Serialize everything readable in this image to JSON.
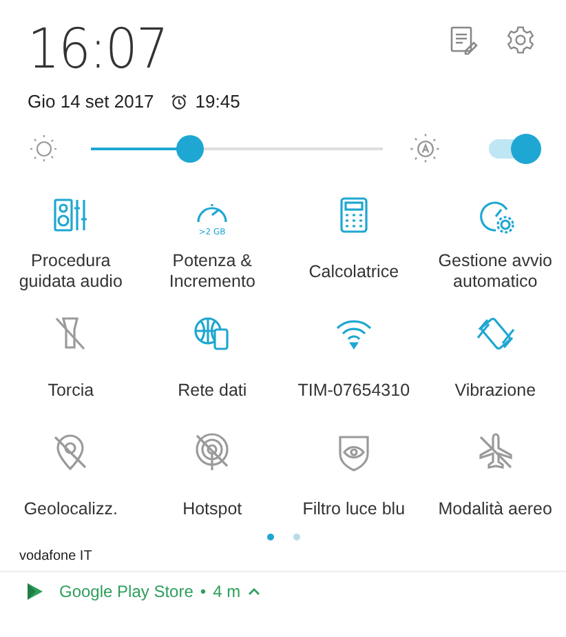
{
  "header": {
    "time": "16:07",
    "date": "Gio 14 set 2017",
    "alarm": "19:45"
  },
  "brightness": {
    "level": 0.34,
    "auto": true
  },
  "tiles": [
    {
      "label": "Procedura guidata audio",
      "on": true
    },
    {
      "label": "Potenza & Incremento",
      "on": true,
      "badge": ">2 GB"
    },
    {
      "label": "Calcolatrice",
      "on": true
    },
    {
      "label": "Gestione avvio automatico",
      "on": true
    },
    {
      "label": "Torcia",
      "on": false
    },
    {
      "label": "Rete dati",
      "on": true
    },
    {
      "label": "TIM-07654310",
      "on": true
    },
    {
      "label": "Vibrazione",
      "on": true
    },
    {
      "label": "Geolocalizz.",
      "on": false
    },
    {
      "label": "Hotspot",
      "on": false
    },
    {
      "label": "Filtro luce blu",
      "on": false
    },
    {
      "label": "Modalità aereo",
      "on": false
    }
  ],
  "pages": [
    {
      "selected": true
    },
    {
      "selected": false
    }
  ],
  "carrier": "vodafone IT",
  "notification": {
    "app": "Google Play Store",
    "separator": "•",
    "time": "4 m"
  }
}
